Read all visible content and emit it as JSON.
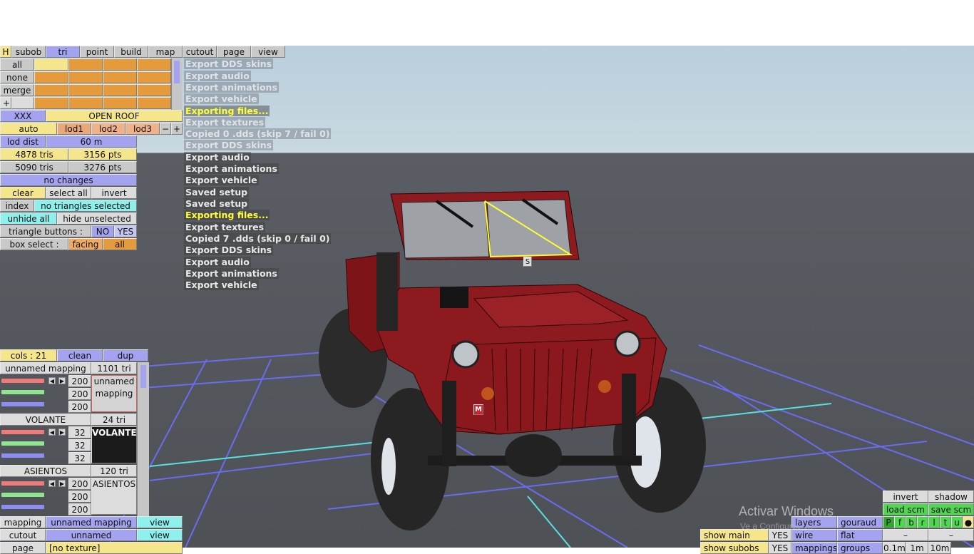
{
  "menu": {
    "h": "H",
    "subob": "subob",
    "tri": "tri",
    "point": "point",
    "build": "build",
    "map": "map",
    "cutout": "cutout",
    "page": "page",
    "view": "view"
  },
  "selection_groups": {
    "all": "all",
    "none": "none",
    "merge": "merge",
    "plus": "+"
  },
  "object": {
    "name": "XXX",
    "variant": "OPEN ROOF"
  },
  "lod": {
    "auto": "auto",
    "lod1": "lod1",
    "lod2": "lod2",
    "lod3": "lod3",
    "minus": "−",
    "plus": "+",
    "dist_label": "lod dist",
    "dist_value": "60 m"
  },
  "stats": {
    "tris1": "4878 tris",
    "pts1": "3156 pts",
    "tris2": "5090 tris",
    "pts2": "3276 pts",
    "changes": "no changes"
  },
  "tri_panel": {
    "clear": "clear",
    "select_all": "select all",
    "invert": "invert",
    "index": "index",
    "selected_status": "no triangles selected",
    "unhide_all": "unhide all",
    "hide_unselected": "hide unselected",
    "triangle_buttons_label": "triangle buttons :",
    "no": "NO",
    "yes": "YES",
    "box_select_label": "box select :",
    "facing": "facing",
    "all": "all"
  },
  "log": [
    "Export DDS skins",
    "Export audio",
    "Export animations",
    "Export vehicle",
    "Exporting files...",
    "Export textures",
    "Copied 0 .dds (skip 7 / fail 0)",
    "Export DDS skins",
    "Export audio",
    "Export animations",
    "Export vehicle",
    "Saved setup",
    "Saved setup",
    "Exporting files...",
    "Export textures",
    "Copied 7 .dds (skip 0 / fail 0)",
    "Export DDS skins",
    "Export audio",
    "Export animations",
    "Export vehicle"
  ],
  "cols_panel": {
    "cols": "cols : 21",
    "clean": "clean",
    "dup": "dup"
  },
  "materials": [
    {
      "name": "unnamed mapping",
      "tris": "1101 tri",
      "values": [
        "200",
        "200",
        "200"
      ],
      "preview": "unnamed mapping"
    },
    {
      "name": "VOLANTE",
      "tris": "24 tri",
      "values": [
        "32",
        "32",
        "32"
      ],
      "preview": "VOLANTE"
    },
    {
      "name": "ASIENTOS",
      "tris": "120 tri",
      "values": [
        "200",
        "200",
        "200"
      ],
      "preview": "ASIENTOS"
    }
  ],
  "bottom_left": {
    "mapping_label": "mapping",
    "mapping_value": "unnamed mapping",
    "view1": "view",
    "cutout_label": "cutout",
    "cutout_value": "unnamed",
    "view2": "view",
    "page_label": "page",
    "page_value": "[no texture]"
  },
  "bottom_right": {
    "invert": "invert",
    "shadow": "shadow",
    "load_scm": "load scm",
    "save_scm": "save scm",
    "layers": "layers",
    "gouraud": "gouraud",
    "wire": "wire",
    "flat": "flat",
    "mappings": "mappings",
    "groups": "groups",
    "show_main": "show main",
    "show_main_val": "YES",
    "show_subobs": "show subobs",
    "show_subobs_val": "YES",
    "toggles": [
      "P",
      "f",
      "b",
      "r",
      "l",
      "t",
      "u",
      "●"
    ],
    "dash1": "–",
    "dash2": "–",
    "dist1": "0.1m",
    "dist2": "1m",
    "dist3": "10m"
  },
  "markers": {
    "s": "S",
    "m": "M"
  },
  "watermark": {
    "title": "Activar Windows",
    "subtitle": "Ve a Configuración"
  },
  "colors": {
    "car_body": "#8c1a1f",
    "grid": "#6a6cf0",
    "axis": "#58e0e0",
    "highlight": "#ffff33"
  }
}
